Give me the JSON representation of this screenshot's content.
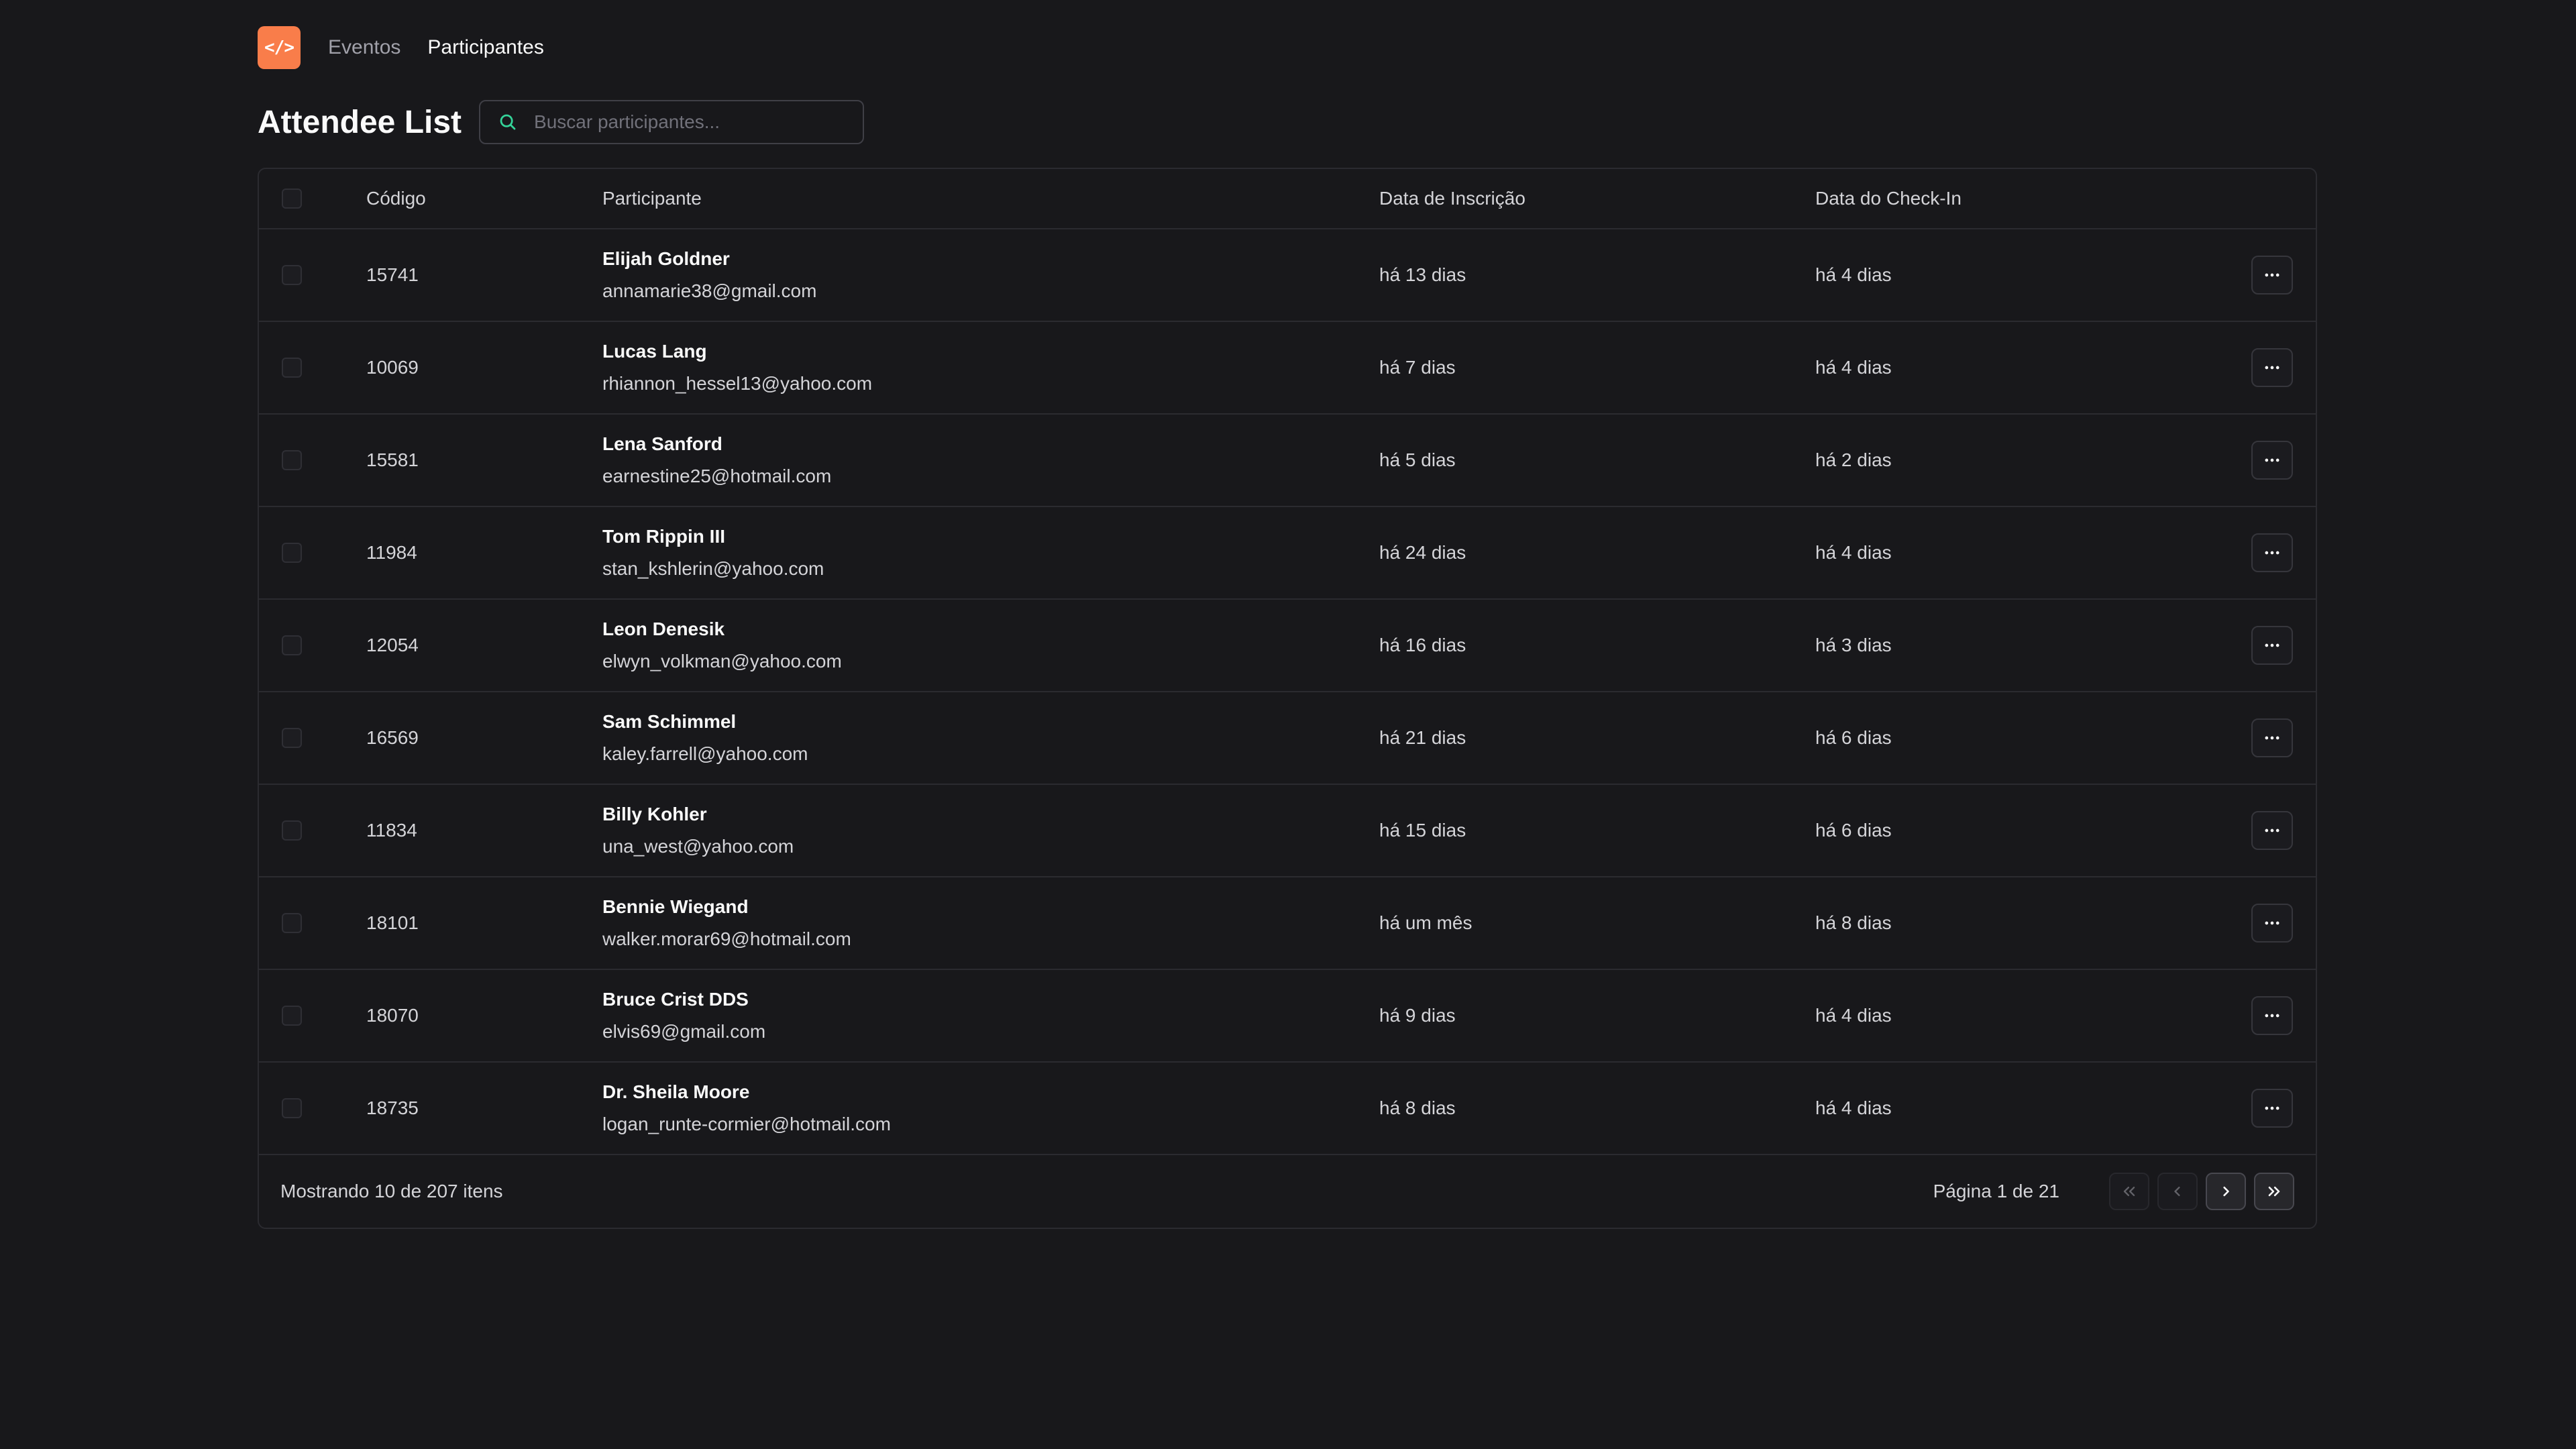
{
  "header": {
    "logo_text": "</>",
    "nav": [
      {
        "label": "Eventos",
        "active": false
      },
      {
        "label": "Participantes",
        "active": true
      }
    ]
  },
  "page": {
    "title": "Attendee List"
  },
  "search": {
    "placeholder": "Buscar participantes...",
    "value": ""
  },
  "table": {
    "columns": {
      "code": "Código",
      "attendee": "Participante",
      "registered": "Data de Inscrição",
      "checkin": "Data do Check-In"
    },
    "rows": [
      {
        "code": "15741",
        "name": "Elijah Goldner",
        "email": "annamarie38@gmail.com",
        "registered": "há 13 dias",
        "checkin": "há 4 dias"
      },
      {
        "code": "10069",
        "name": "Lucas Lang",
        "email": "rhiannon_hessel13@yahoo.com",
        "registered": "há 7 dias",
        "checkin": "há 4 dias"
      },
      {
        "code": "15581",
        "name": "Lena Sanford",
        "email": "earnestine25@hotmail.com",
        "registered": "há 5 dias",
        "checkin": "há 2 dias"
      },
      {
        "code": "11984",
        "name": "Tom Rippin III",
        "email": "stan_kshlerin@yahoo.com",
        "registered": "há 24 dias",
        "checkin": "há 4 dias"
      },
      {
        "code": "12054",
        "name": "Leon Denesik",
        "email": "elwyn_volkman@yahoo.com",
        "registered": "há 16 dias",
        "checkin": "há 3 dias"
      },
      {
        "code": "16569",
        "name": "Sam Schimmel",
        "email": "kaley.farrell@yahoo.com",
        "registered": "há 21 dias",
        "checkin": "há 6 dias"
      },
      {
        "code": "11834",
        "name": "Billy Kohler",
        "email": "una_west@yahoo.com",
        "registered": "há 15 dias",
        "checkin": "há 6 dias"
      },
      {
        "code": "18101",
        "name": "Bennie Wiegand",
        "email": "walker.morar69@hotmail.com",
        "registered": "há um mês",
        "checkin": "há 8 dias"
      },
      {
        "code": "18070",
        "name": "Bruce Crist DDS",
        "email": "elvis69@gmail.com",
        "registered": "há 9 dias",
        "checkin": "há 4 dias"
      },
      {
        "code": "18735",
        "name": "Dr. Sheila Moore",
        "email": "logan_runte-cormier@hotmail.com",
        "registered": "há 8 dias",
        "checkin": "há 4 dias"
      }
    ]
  },
  "footer": {
    "showing": "Mostrando 10 de 207 itens",
    "page_info": "Página 1 de 21"
  },
  "icons": {
    "logo": "code-icon",
    "search": "search-icon",
    "row_action": "ellipsis-icon",
    "first": "chevrons-left-icon",
    "prev": "chevron-left-icon",
    "next": "chevron-right-icon",
    "last": "chevrons-right-icon"
  },
  "colors": {
    "background": "#18181b",
    "accent": "#f97d4a",
    "search_icon": "#34d399",
    "border": "#2b2b30"
  }
}
